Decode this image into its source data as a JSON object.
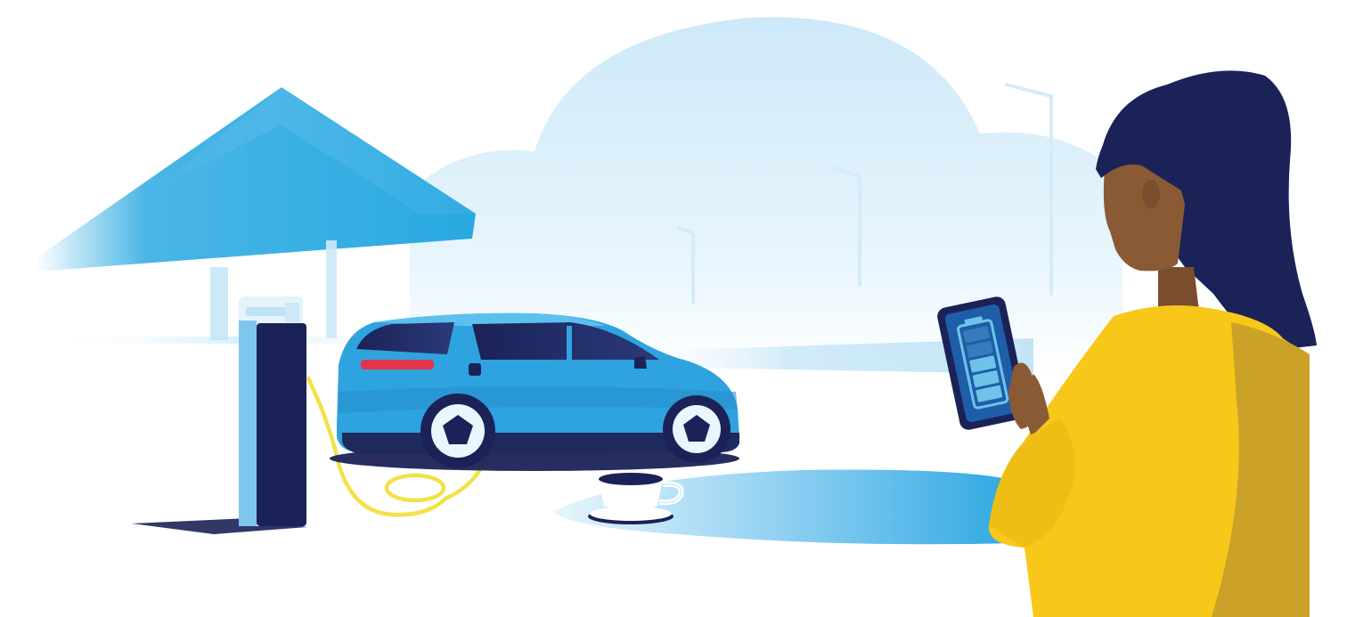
{
  "scene": {
    "subject": "ev-charging-illustration",
    "colors": {
      "background": "#ffffff",
      "sky_light": "#dff1fb",
      "sky_mid": "#bfe3f6",
      "canopy": "#29a9e1",
      "car_body": "#2ea3e0",
      "car_dark": "#1f2a5c",
      "navy": "#1b2257",
      "cable_yellow": "#f2e14a",
      "shirt_yellow": "#f7c81a",
      "shirt_shadow": "#c9a227",
      "skin": "#8a5a35",
      "hair": "#1b2257",
      "phone_screen": "#1e5ea8",
      "battery_cells": "#6fc3ea",
      "water": "#3eb4e6"
    },
    "battery": {
      "icon": "battery-charging-icon",
      "level": 0.6
    },
    "icons": {
      "charger": "charging-station-icon",
      "car": "electric-car-icon",
      "cup": "coffee-cup-icon",
      "phone": "smartphone-icon",
      "streetlight": "street-lamp-icon"
    }
  }
}
